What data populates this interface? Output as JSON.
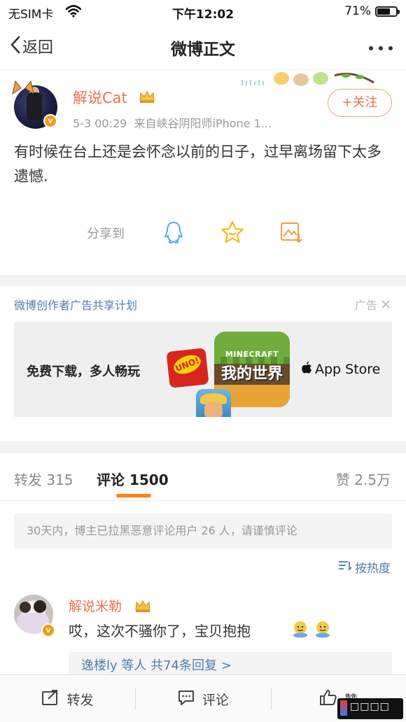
{
  "status_bar": {
    "carrier": "无SIM卡",
    "time": "下午12:02",
    "battery_percent": "71%",
    "battery_level": 0.71
  },
  "nav": {
    "back_label": "返回",
    "title": "微博正文"
  },
  "post": {
    "username": "解说Cat",
    "meta_time": "5-3 00:29",
    "meta_source": "来自峡谷阴阳师iPhone 1...",
    "follow_label": "+关注",
    "content": "有时候在台上还是会怀念以前的日子，过早离场留下太多遗憾.",
    "share_label": "分享到",
    "verified_badge": "v"
  },
  "ad": {
    "title": "微博创作者广告共享计划",
    "ad_label": "广告",
    "banner_text": "免费下载，多人畅玩",
    "app_store": "App Store",
    "uno_text": "UNO!",
    "minecraft_line1": "MINECRAFT",
    "minecraft_line2": "我的世界"
  },
  "tabs": {
    "repost_label": "转发",
    "repost_count": "315",
    "comment_label": "评论",
    "comment_count": "1500",
    "like_label": "赞",
    "like_count": "2.5万"
  },
  "comments": {
    "notice": "30天内，博主已拉黑恶意评论用户 26 人，请谨慎评论",
    "sort_label": "按热度",
    "items": [
      {
        "name": "解说米勒",
        "text": "哎，这次不骚你了，宝贝抱抱",
        "reply_text": "逸楼ly 等人  共74条回复 >",
        "verified_badge": "v"
      }
    ]
  },
  "toolbar": {
    "repost": "转发",
    "comment": "评论",
    "like": "赞"
  },
  "colors": {
    "accent": "#ff8200",
    "username": "#eb7350",
    "link": "#507daf"
  }
}
